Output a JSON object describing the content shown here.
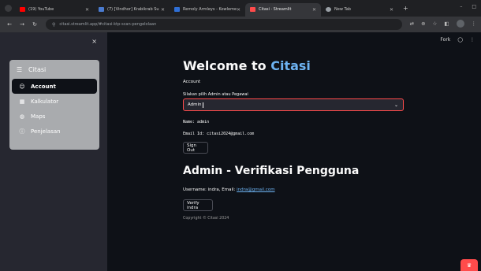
{
  "browser": {
    "tabs": [
      {
        "label": "(19) YouTube",
        "color": "#ff0000",
        "active": false
      },
      {
        "label": "(7) [Vindhor] Krabikrab Su",
        "color": "#4a7bd0",
        "active": false
      },
      {
        "label": "Remoly Armleys - Kowleme",
        "color": "#2f6fd6",
        "active": false
      },
      {
        "label": "Citasi · Streamlit",
        "color": "#ff4b4b",
        "active": true
      },
      {
        "label": "New Tab",
        "color": "#9aa0a6",
        "active": false
      }
    ],
    "url": "citasi.streamlit.app/#citasi-ktp-scan-pengelolaan"
  },
  "sidebar": {
    "close": "×",
    "menu_title": "Citasi",
    "items": [
      {
        "label": "Account",
        "icon": "user-circle-icon",
        "glyph": "☺",
        "active": true
      },
      {
        "label": "Kalkulator",
        "icon": "calculator-icon",
        "glyph": "▦",
        "active": false
      },
      {
        "label": "Maps",
        "icon": "globe-icon",
        "glyph": "◍",
        "active": false
      },
      {
        "label": "Penjelasan",
        "icon": "info-icon",
        "glyph": "ⓘ",
        "active": false
      }
    ]
  },
  "header": {
    "fork": "Fork"
  },
  "main": {
    "welcome_prefix": "Welcome to ",
    "welcome_brand": "Citasi",
    "account_label": "Account",
    "select_label": "Silakan pilih Admin atau Pegawai",
    "select_value": "Admin",
    "name_line": "Name: admin",
    "email_line": "Email Id: citasi2024@gmail.com",
    "signout": "Sign Out",
    "section_title": "Admin - Verifikasi Pengguna",
    "username_text": "Username: indra, Email: ",
    "username_email": "indra@gmail.com",
    "verify_button": "Verify indra",
    "copyright": "Copyright © Citasi 2024"
  },
  "colors": {
    "accent": "#6db3f2",
    "streamlit_red": "#ff4b4b",
    "sidebar_bg": "#262730",
    "app_bg": "#0e1117"
  }
}
